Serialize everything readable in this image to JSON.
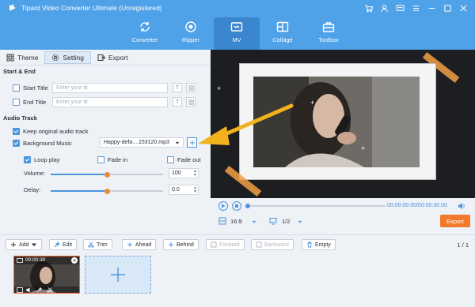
{
  "app": {
    "title": "Tipard Video Converter Ultimate (Unregistered)"
  },
  "nav": {
    "tabs": [
      {
        "label": "Converter",
        "icon": "converter-icon"
      },
      {
        "label": "Ripper",
        "icon": "ripper-icon"
      },
      {
        "label": "MV",
        "icon": "mv-icon",
        "active": true
      },
      {
        "label": "Collage",
        "icon": "collage-icon"
      },
      {
        "label": "Toolbox",
        "icon": "toolbox-icon"
      }
    ]
  },
  "subtabs": {
    "theme": "Theme",
    "setting": "Setting",
    "export": "Export"
  },
  "start_end": {
    "header": "Start & End",
    "start_title_label": "Start Title",
    "end_title_label": "End Title",
    "start_placeholder": "Enter your tit",
    "end_placeholder": "Enter your tit",
    "font_btn": "T"
  },
  "audio": {
    "header": "Audio Track",
    "keep_original": "Keep original audio track",
    "background_music": "Background Music",
    "music_file": "Happy-defa....153120.mp3",
    "loop_play": "Loop play",
    "fade_in": "Fade in",
    "fade_out": "Fade out",
    "volume_label": "Volume:",
    "volume_value": "100",
    "volume_level": 0.5,
    "delay_label": "Delay:",
    "delay_value": "0.0",
    "delay_level": 0.5
  },
  "player": {
    "time": "00:00:00.00/00:00:30.00",
    "aspect": "16:9",
    "page": "1/2",
    "export_label": "Export"
  },
  "toolbar": {
    "add": "Add",
    "edit": "Edit",
    "trim": "Trim",
    "ahead": "Ahead",
    "behind": "Behind",
    "forward": "Forward",
    "backward": "Backward",
    "empty": "Empty",
    "pager": "1 / 1"
  },
  "timeline": {
    "clip_duration": "00:00:30"
  },
  "colors": {
    "accent": "#4fa1e8",
    "export": "#f27a2c",
    "knob": "#f08b35"
  }
}
